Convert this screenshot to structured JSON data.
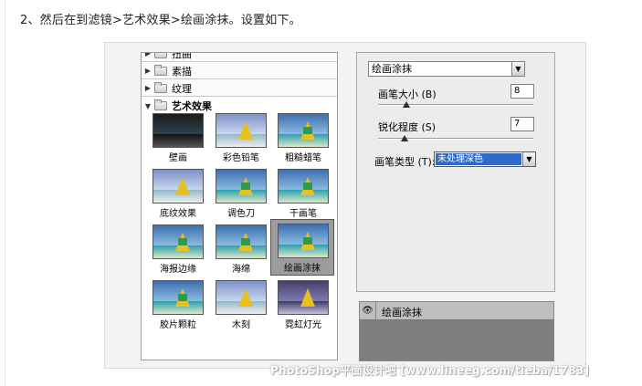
{
  "caption": "2、然后在到滤镜>艺术效果>绘画涂抹。设置如下。",
  "gallery": {
    "categories": [
      {
        "label": "扭曲",
        "expanded": false
      },
      {
        "label": "素描",
        "expanded": false
      },
      {
        "label": "纹理",
        "expanded": false
      },
      {
        "label": "艺术效果",
        "expanded": true
      }
    ],
    "thumbnails": [
      {
        "label": "壁画",
        "style": "dark",
        "selected": false
      },
      {
        "label": "彩色铅笔",
        "style": "fade",
        "selected": false
      },
      {
        "label": "粗糙蜡笔",
        "style": "normal",
        "selected": false
      },
      {
        "label": "底纹效果",
        "style": "normal",
        "selected": false
      },
      {
        "label": "调色刀",
        "style": "normal",
        "selected": false
      },
      {
        "label": "干画笔",
        "style": "normal",
        "selected": false
      },
      {
        "label": "海报边缘",
        "style": "normal",
        "selected": false
      },
      {
        "label": "海绵",
        "style": "normal",
        "selected": false
      },
      {
        "label": "绘画涂抹",
        "style": "normal",
        "selected": true
      },
      {
        "label": "胶片颗粒",
        "style": "normal",
        "selected": false
      },
      {
        "label": "木刻",
        "style": "fade",
        "selected": false
      },
      {
        "label": "霓虹灯光",
        "style": "neon",
        "selected": false
      }
    ]
  },
  "settings": {
    "filter_select": "绘画涂抹",
    "brush_size": {
      "label": "画笔大小 (B)",
      "value": "8",
      "fraction": 0.18
    },
    "sharpness": {
      "label": "锐化程度 (S)",
      "value": "7",
      "fraction": 0.17
    },
    "brush_type": {
      "label": "画笔类型 (T):",
      "value": "未处理深色"
    }
  },
  "layers": {
    "items": [
      {
        "label": "绘画涂抹",
        "visible": true
      }
    ]
  },
  "watermark": "PhotoShop平面设计吧 [www.lineeg.com/tieba/1783]"
}
